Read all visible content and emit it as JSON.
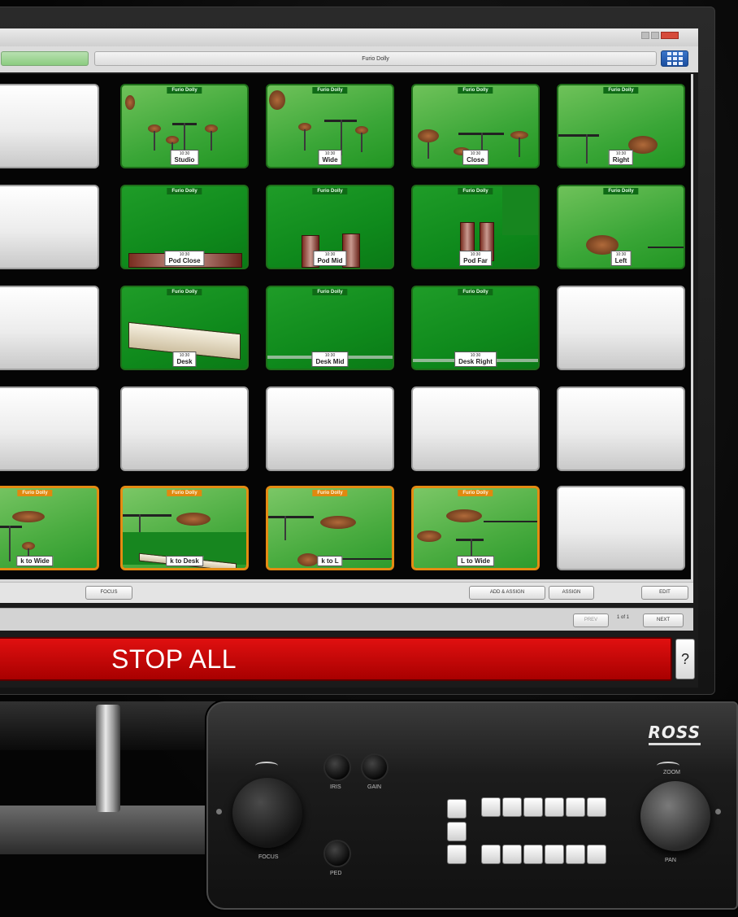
{
  "window": {
    "preset_name_field": "Furio Dolly"
  },
  "grid": {
    "camera_label": "Furio Dolly",
    "timestamp": "10:30",
    "presets": {
      "r1c2": "Studio",
      "r1c3": "Wide",
      "r1c4": "Close",
      "r1c5": "Right",
      "r2c2": "Pod Close",
      "r2c3": "Pod Mid",
      "r2c4": "Pod Far",
      "r2c5": "Left",
      "r3c2": "Desk",
      "r3c3": "Desk Mid",
      "r3c4": "Desk Right",
      "r5c1": "k to Wide",
      "r5c2": "k to Desk",
      "r5c3": "k to L",
      "r5c4": "L to Wide"
    }
  },
  "actions": {
    "focus": "FOCUS",
    "add_assign": "ADD & ASSIGN",
    "assign": "ASSIGN",
    "edit": "EDIT"
  },
  "pager": {
    "prev": "PREV",
    "page": "1 of 1",
    "next": "NEXT"
  },
  "stop_all": "STOP ALL",
  "help": "?",
  "controller": {
    "brand": "ROSS",
    "zoom_label": "ZOOM",
    "pan_label": "PAN",
    "left_stick_label": "FOCUS",
    "knob_labels": [
      "IRIS",
      "GAIN",
      "PED"
    ]
  },
  "colors": {
    "stop_red": "#d00000",
    "preset_green": "#3aa637",
    "sequence_orange": "#e48b12",
    "grid_toggle_blue": "#2a62b8"
  }
}
